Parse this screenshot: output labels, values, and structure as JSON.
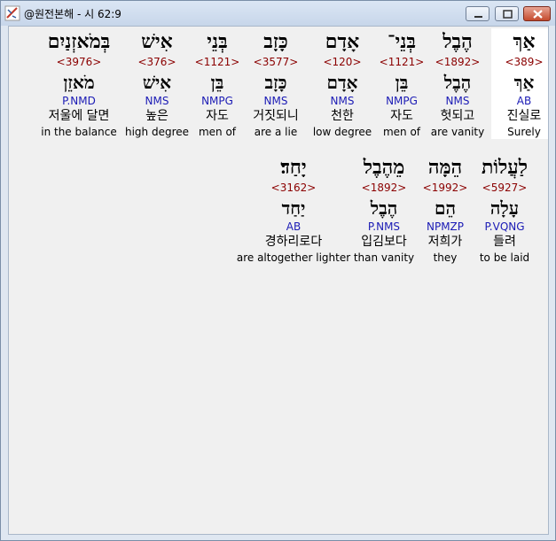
{
  "window": {
    "title": "@원전본해 - 시 62:9"
  },
  "rows": [
    {
      "words": [
        {
          "hebrew": "אַךְ",
          "strong": "<389>",
          "lemma": "אַךְ",
          "parse": "AB",
          "korean": "진실로",
          "english": "Surely",
          "selected": true
        },
        {
          "hebrew": "הֶבֶל",
          "strong": "<1892>",
          "lemma": "הֶבֶל",
          "parse": "NMS",
          "korean": "헛되고",
          "english": "are vanity"
        },
        {
          "hebrew": "בְּנֵי־",
          "strong": "<1121>",
          "lemma": "בֵּן",
          "parse": "NMPG",
          "korean": "자도",
          "english": "men of"
        },
        {
          "hebrew": "אָדָם",
          "strong": "<120>",
          "lemma": "אָדָם",
          "parse": "NMS",
          "korean": "천한",
          "english": "low degree"
        },
        {
          "hebrew": "כָּזָב",
          "strong": "<3577>",
          "lemma": "כָּזָב",
          "parse": "NMS",
          "korean": "거짓되니",
          "english": "are a lie"
        },
        {
          "hebrew": "בְּנֵי",
          "strong": "<1121>",
          "lemma": "בֵּן",
          "parse": "NMPG",
          "korean": "자도",
          "english": "men of"
        },
        {
          "hebrew": "אִישׁ",
          "strong": "<376>",
          "lemma": "אִישׁ",
          "parse": "NMS",
          "korean": "높은",
          "english": "high degree"
        },
        {
          "hebrew": "בְּמֹאזְנַיִם",
          "strong": "<3976>",
          "lemma": "מֹאזֵן",
          "parse": "P.NMD",
          "korean": "저울에 달면",
          "english": "in the balance"
        }
      ]
    },
    {
      "words": [
        {
          "hebrew": "לַעֲלוֹת",
          "strong": "<5927>",
          "lemma": "עָלָה",
          "parse": "P.VQNG",
          "korean": "들려",
          "english": "to be laid"
        },
        {
          "hebrew": "הֵמָּה",
          "strong": "<1992>",
          "lemma": "הֵם",
          "parse": "NPMZP",
          "korean": "저희가",
          "english": "they"
        },
        {
          "hebrew": "מֵהֶבֶל",
          "strong": "<1892>",
          "lemma": "הֶבֶל",
          "parse": "P.NMS",
          "korean": "입김보다",
          "english": "than vanity"
        },
        {
          "hebrew": "יָחַד׃",
          "strong": "<3162>",
          "lemma": "יַחַד",
          "parse": "AB",
          "korean": "경하리로다",
          "english": "are altogether lighter"
        }
      ]
    }
  ]
}
